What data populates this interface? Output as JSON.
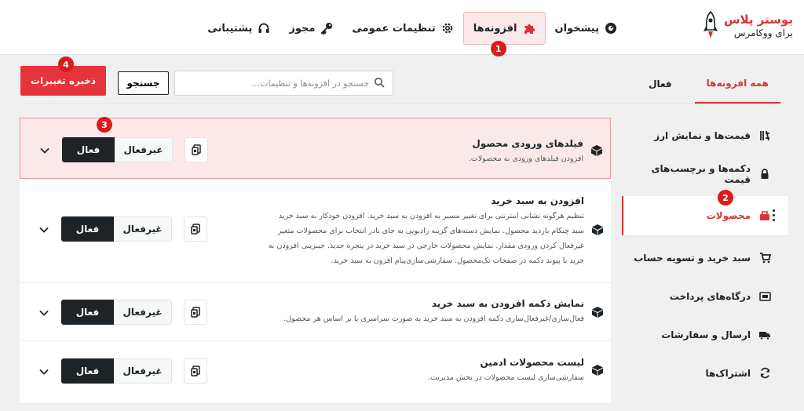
{
  "brand": {
    "title": "بوستر پلاس",
    "subtitle": "برای ووکامرس"
  },
  "nav": [
    {
      "label": "پیشخوان",
      "icon": "dashboard-icon"
    },
    {
      "label": "افزونه‌ها",
      "icon": "puzzle-icon",
      "active": true,
      "badge": "1"
    },
    {
      "label": "تنظیمات عمومی",
      "icon": "gear-icon"
    },
    {
      "label": "مجوز",
      "icon": "key-icon"
    },
    {
      "label": "پشتیبانی",
      "icon": "headset-icon"
    }
  ],
  "tabs": {
    "all": "همه افزونه‌ها",
    "active": "فعال"
  },
  "search": {
    "placeholder": "جستجو در افزونه‌ها و تنظیمات...",
    "button": "جستجو"
  },
  "save": {
    "label": "ذخیره تغییرات",
    "badge": "4"
  },
  "sidebar": {
    "items": [
      {
        "label": "قیمت‌ها و نمایش ارز",
        "icon": "currency-icon"
      },
      {
        "label": "دکمه‌ها و برچسب‌های قیمت",
        "icon": "lock-icon"
      },
      {
        "label": "محصولات",
        "icon": "product-box-icon",
        "active": true,
        "badge": "2"
      },
      {
        "label": "سبد خرید و تسویه حساب",
        "icon": "cart-icon"
      },
      {
        "label": "درگاه‌های پرداخت",
        "icon": "payment-icon"
      },
      {
        "label": "ارسال و سفارشات",
        "icon": "truck-icon"
      },
      {
        "label": "اشتراک‌ها",
        "icon": "refresh-icon"
      }
    ]
  },
  "modules": {
    "badge": "3",
    "on_label": "فعال",
    "off_label": "غیرفعال",
    "items": [
      {
        "title": "فیلدهای ورودی محصول",
        "desc": [
          "افزودن فیلدهای ورودی به محصولات."
        ],
        "highlight": true
      },
      {
        "title": "افزودن به سبد خرید",
        "desc": [
          "تنظیم هرگونه نشانی اینترنتی برای تغییر مسیر به افزودن به سبد خرید. افزودن خودکار به سبد خرید",
          "سبد چیکام بازدید محصول. نمایش دسته‌های گزینه رادیویی به جای نادر انتخاب برای محصولات متغیر",
          "غیرفعال کردن ورودی مقدار. نمایش محصولات خارجی در سبد خرید در پنجره جدید. جیبرینی افزودن به",
          "خرید با پیوند دکمه در صفحات تک‌محصول. سفارشی‌سازی‌پیام افزون به سبد خرید."
        ]
      },
      {
        "title": "نمایش دکمه افزودن به سبد خرید",
        "desc": [
          "فعال‌سازی/غیرفعال‌سازی دکمه افزودن به سبد خرید به صورت سراسری یا بر اساس هر محصول."
        ]
      },
      {
        "title": "لیست محصولات ادمین",
        "desc": [
          "سفارشی‌سازی لیست محصولات در بخش مدیریت."
        ]
      }
    ]
  },
  "colors": {
    "accent": "#d63638",
    "dark": "#1d2327",
    "save": "#e5343b",
    "badge": "#d91c1c"
  }
}
